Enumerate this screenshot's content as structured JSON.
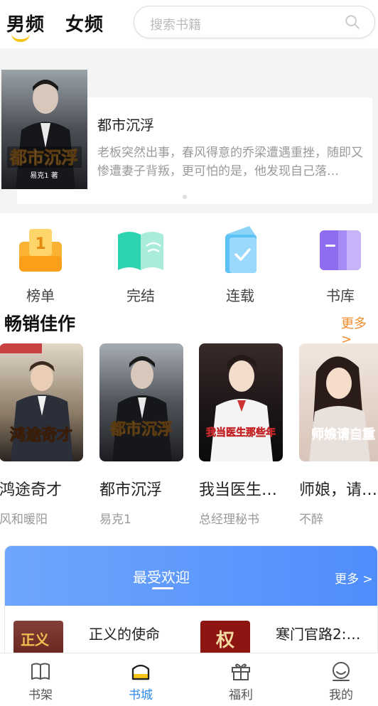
{
  "header": {
    "tabs": [
      {
        "label": "男频",
        "active": true
      },
      {
        "label": "女频",
        "active": false
      }
    ],
    "search": {
      "placeholder": "搜索书籍"
    }
  },
  "banner": {
    "title": "都市沉浮",
    "description": "老板突然出事，春风得意的乔梁遭遇重挫，随即又惨遭妻子背叛，更可怕的是，他发现自己落…",
    "cover_title": "都市沉浮",
    "cover_author": "易克1 著"
  },
  "categories": [
    {
      "label": "榜单",
      "icon": "rank-icon"
    },
    {
      "label": "完结",
      "icon": "book-open-icon"
    },
    {
      "label": "连载",
      "icon": "serial-icon"
    },
    {
      "label": "书库",
      "icon": "library-icon"
    }
  ],
  "bestsellers": {
    "title": "畅销佳作",
    "more": "更多 >",
    "books": [
      {
        "title": "鸿途奇才",
        "author": "风和暖阳",
        "cover_text": "鸿途奇才"
      },
      {
        "title": "都市沉浮",
        "author": "易克1",
        "cover_text": "都市沉浮"
      },
      {
        "title": "我当医生的那些年",
        "author": "总经理秘书",
        "cover_text": "我当医生那些年"
      },
      {
        "title": "师娘，请自重",
        "author": "不醉",
        "cover_text": "师娘请自重"
      }
    ]
  },
  "popular": {
    "title": "最受欢迎",
    "more": "更多 >",
    "items": [
      {
        "title": "正义的使命"
      },
      {
        "title": "寒门官路2:…"
      }
    ]
  },
  "tabbar": {
    "items": [
      {
        "label": "书架",
        "icon": "bookshelf-icon",
        "active": false
      },
      {
        "label": "书城",
        "icon": "bookstore-icon",
        "active": true
      },
      {
        "label": "福利",
        "icon": "gift-icon",
        "active": false
      },
      {
        "label": "我的",
        "icon": "profile-icon",
        "active": false
      }
    ]
  },
  "colors": {
    "accent_blue": "#2f8ae5",
    "more_orange": "#ef8b2c",
    "indicator_yellow": "#f5c518",
    "popular_gradient_start": "#6ea6fd",
    "popular_gradient_end": "#4f8dfb"
  }
}
